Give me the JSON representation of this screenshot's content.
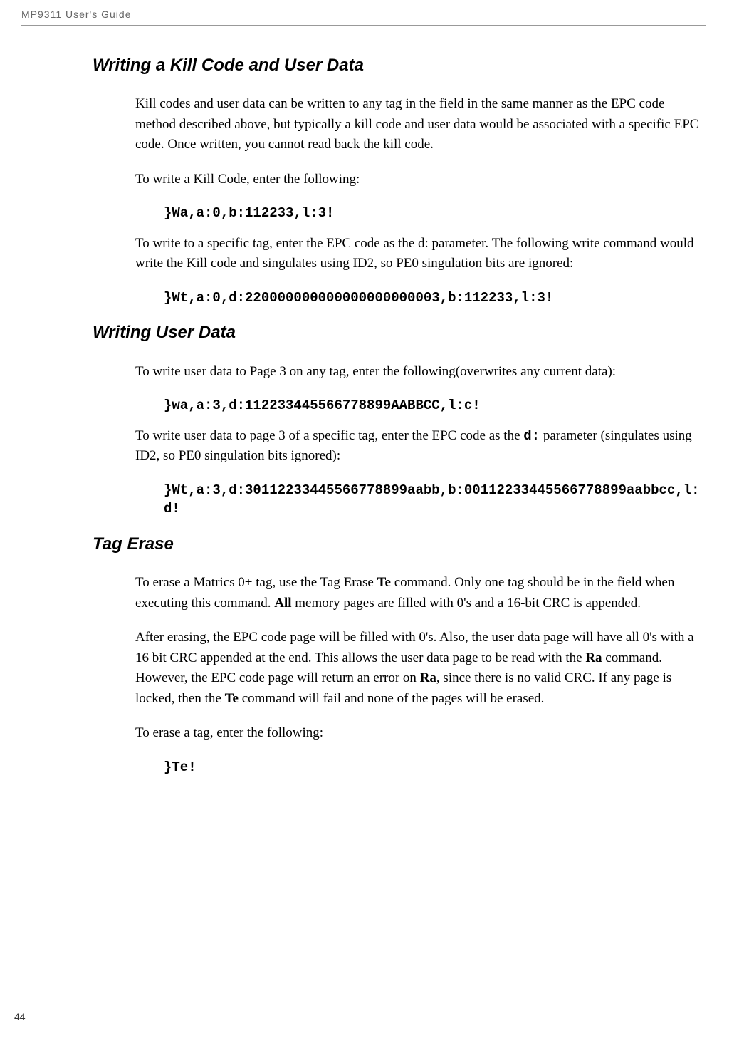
{
  "header": {
    "title": "MP9311 User's Guide"
  },
  "sections": {
    "kill_code": {
      "title": "Writing a Kill Code and User Data",
      "para1": "Kill codes and user data can be written to any tag in the field in the same manner as the EPC code method described above, but typically a kill code and user data would be associated with a specific EPC code. Once written, you cannot read back the kill code.",
      "para2": "To write a Kill Code, enter the following:",
      "code1": "}Wa,a:0,b:112233,l:3!",
      "para3": "To write to a specific tag, enter the EPC code as the d: parameter. The following write command would write the Kill code and singulates using ID2, so PE0 singulation bits are ignored:",
      "code2": "}Wt,a:0,d:220000000000000000000003,b:112233,l:3!"
    },
    "user_data": {
      "title": "Writing User Data",
      "para1": "To write user data to Page 3 on any tag, enter the following(overwrites any current data):",
      "code1": "}wa,a:3,d:112233445566778899AABBCC,l:c!",
      "para2_pre": "To write user data to page 3 of a specific tag, enter the EPC code as the ",
      "para2_code": "d:",
      "para2_post": " parameter (singulates using ID2, so PE0 singulation bits ignored):",
      "code2": "}Wt,a:3,d:30112233445566778899aabb,b:00112233445566778899aabbcc,l:d!"
    },
    "tag_erase": {
      "title": "Tag Erase",
      "para1_a": "To erase a Matrics 0+ tag, use the Tag Erase ",
      "para1_b": "Te",
      "para1_c": " command. Only one tag should be in the field when executing this command. ",
      "para1_d": "All",
      "para1_e": " memory pages are filled with 0's and a 16-bit CRC is appended.",
      "para2_a": "After erasing, the EPC code page will be filled with 0's. Also, the user data page will have all 0's with a 16 bit CRC appended at the end. This allows the user data page to be read with the ",
      "para2_b": "Ra",
      "para2_c": " command. However, the EPC code page will return an error on ",
      "para2_d": "Ra",
      "para2_e": ", since there is no valid CRC. If any page is locked, then the ",
      "para2_f": "Te",
      "para2_g": " command will fail and none of the pages will be erased.",
      "para3": "To erase a tag, enter the following:",
      "code1": "}Te!"
    }
  },
  "page_number": "44"
}
